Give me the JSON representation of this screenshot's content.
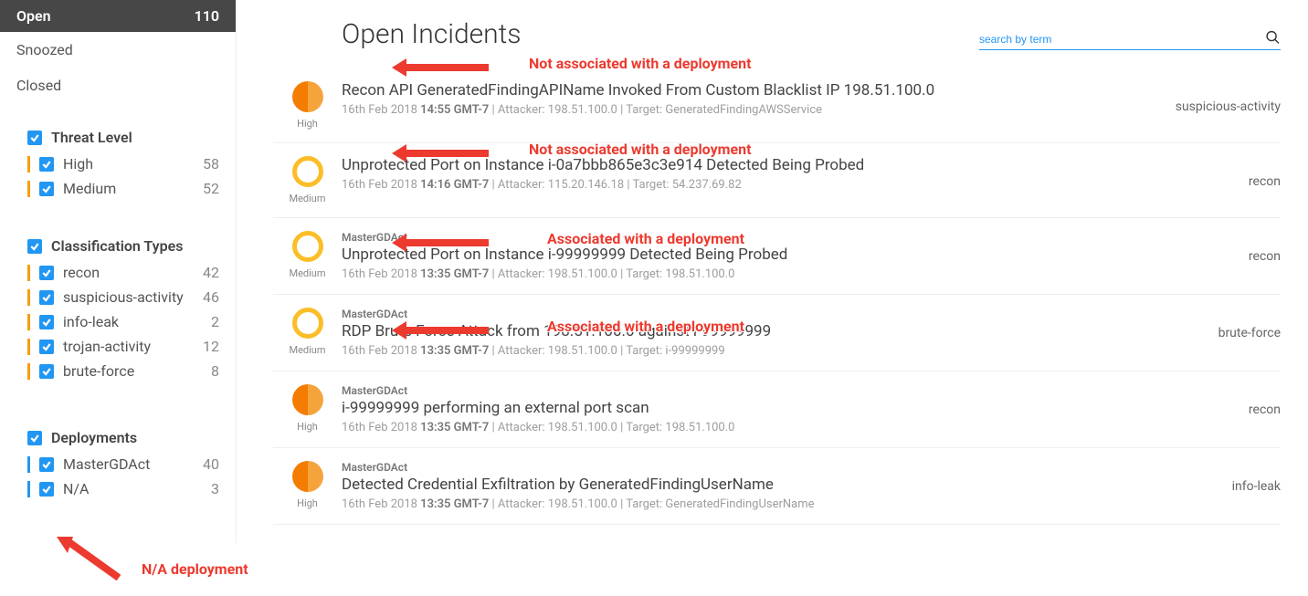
{
  "sidebar": {
    "tabs": [
      {
        "label": "Open",
        "count": "110",
        "active": true
      },
      {
        "label": "Snoozed"
      },
      {
        "label": "Closed"
      }
    ],
    "threat_header": "Threat Level",
    "threat": [
      {
        "label": "High",
        "count": "58"
      },
      {
        "label": "Medium",
        "count": "52"
      }
    ],
    "class_header": "Classification Types",
    "classifications": [
      {
        "label": "recon",
        "count": "42"
      },
      {
        "label": "suspicious-activity",
        "count": "46"
      },
      {
        "label": "info-leak",
        "count": "2"
      },
      {
        "label": "trojan-activity",
        "count": "12"
      },
      {
        "label": "brute-force",
        "count": "8"
      }
    ],
    "dep_header": "Deployments",
    "deployments": [
      {
        "label": "MasterGDAct",
        "count": "40"
      },
      {
        "label": "N/A",
        "count": "3"
      }
    ]
  },
  "header": {
    "title": "Open Incidents"
  },
  "search": {
    "placeholder": "search by term"
  },
  "incidents": [
    {
      "sev": "High",
      "sevclass": "high",
      "dep": "",
      "title": "Recon API GeneratedFindingAPIName Invoked From Custom Blacklist IP 198.51.100.0",
      "date": "16th Feb 2018",
      "time": "14:55 GMT-7",
      "attacker": "198.51.100.0",
      "target": "GeneratedFindingAWSService",
      "class": "suspicious-activity"
    },
    {
      "sev": "Medium",
      "sevclass": "medium",
      "dep": "",
      "title": "Unprotected Port on Instance i-0a7bbb865e3c3e914 Detected Being Probed",
      "date": "16th Feb 2018",
      "time": "14:16 GMT-7",
      "attacker": "115.20.146.18",
      "target": "54.237.69.82",
      "class": "recon"
    },
    {
      "sev": "Medium",
      "sevclass": "medium",
      "dep": "MasterGDAct",
      "title": "Unprotected Port on Instance i-99999999 Detected Being Probed",
      "date": "16th Feb 2018",
      "time": "13:35 GMT-7",
      "attacker": "198.51.100.0",
      "target": "198.51.100.0",
      "class": "recon"
    },
    {
      "sev": "Medium",
      "sevclass": "medium",
      "dep": "MasterGDAct",
      "title": "RDP Brute Force Attack from 198.51.100.0 against i-99999999",
      "date": "16th Feb 2018",
      "time": "13:35 GMT-7",
      "attacker": "198.51.100.0",
      "target": "i-99999999",
      "class": "brute-force"
    },
    {
      "sev": "High",
      "sevclass": "high",
      "dep": "MasterGDAct",
      "title": "i-99999999 performing an external port scan",
      "date": "16th Feb 2018",
      "time": "13:35 GMT-7",
      "attacker": "198.51.100.0",
      "target": "198.51.100.0",
      "class": "recon"
    },
    {
      "sev": "High",
      "sevclass": "high",
      "dep": "MasterGDAct",
      "title": "Detected Credential Exfiltration by GeneratedFindingUserName",
      "date": "16th Feb 2018",
      "time": "13:35 GMT-7",
      "attacker": "198.51.100.0",
      "target": "GeneratedFindingUserName",
      "class": "info-leak"
    }
  ],
  "annotations": {
    "not_assoc": "Not associated with a deployment",
    "assoc": "Associated with a deployment",
    "na": "N/A deployment"
  }
}
